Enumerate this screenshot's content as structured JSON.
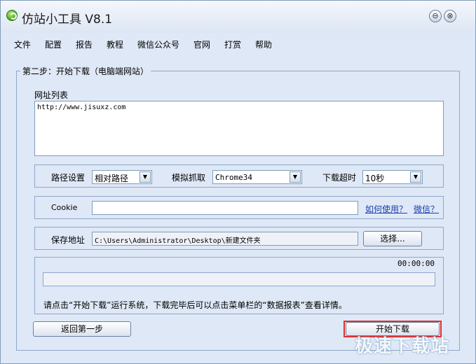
{
  "window": {
    "title": "仿站小工具 V8.1",
    "min_glyph": "⊖",
    "close_glyph": "⊗"
  },
  "menu": [
    "文件",
    "配置",
    "报告",
    "教程",
    "微信公众号",
    "官网",
    "打赏",
    "帮助"
  ],
  "step": {
    "group_title": "第二步：开始下载（电脑端网站）",
    "url_list_label": "网址列表",
    "url_list_value": "http://www.jisuxz.com"
  },
  "options": {
    "path_label": "路径设置",
    "path_value": "相对路径",
    "mimic_label": "模拟抓取",
    "mimic_value": "Chrome34",
    "timeout_label": "下载超时",
    "timeout_value": "10秒"
  },
  "cookie": {
    "label": "Cookie",
    "value": "",
    "how_link": "如何使用？",
    "wechat_link": "微信？"
  },
  "save": {
    "label": "保存地址",
    "value": "C:\\Users\\Administrator\\Desktop\\新建文件夹",
    "choose_button": "选择..."
  },
  "progress": {
    "timer": "00:00:00",
    "fraction": 0,
    "hint": "请点击“开始下载”运行系统，下载完毕后可以点击菜单栏的“数据报表”查看详情。"
  },
  "buttons": {
    "back": "返回第一步",
    "start": "开始下载"
  },
  "watermark": "极速下载站"
}
